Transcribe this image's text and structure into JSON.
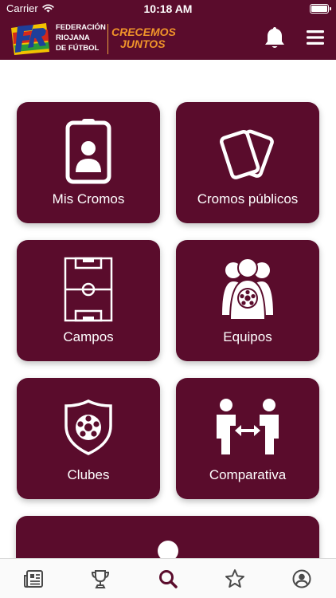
{
  "status_bar": {
    "carrier": "Carrier",
    "time": "10:18 AM",
    "icons": [
      "wifi-icon",
      "battery-icon"
    ]
  },
  "header": {
    "federation_lines": [
      "FEDERACIÓN",
      "RIOJANA",
      "DE FÚTBOL"
    ],
    "slogan_lines": [
      "CRECEMOS",
      "JUNTOS"
    ],
    "logo_letters": "FR",
    "icons": [
      "bell-icon",
      "hamburger-menu-icon"
    ]
  },
  "menu": {
    "items": [
      {
        "label": "Mis Cromos",
        "icon": "id-badge-icon"
      },
      {
        "label": "Cromos públicos",
        "icon": "cards-icon"
      },
      {
        "label": "Campos",
        "icon": "soccer-field-icon"
      },
      {
        "label": "Equipos",
        "icon": "team-icon"
      },
      {
        "label": "Clubes",
        "icon": "club-shield-icon"
      },
      {
        "label": "Comparativa",
        "icon": "compare-players-icon"
      }
    ]
  },
  "tab_bar": {
    "active_tab": "search",
    "tabs": [
      "news-icon",
      "trophy-icon",
      "search-icon",
      "star-icon",
      "profile-icon"
    ]
  },
  "colors": {
    "brand": "#5a0c2c",
    "accent": "#f0942a",
    "card_text": "#ffffff",
    "tab_icon": "#4a4a4a",
    "tab_active": "#5a0c2c"
  }
}
